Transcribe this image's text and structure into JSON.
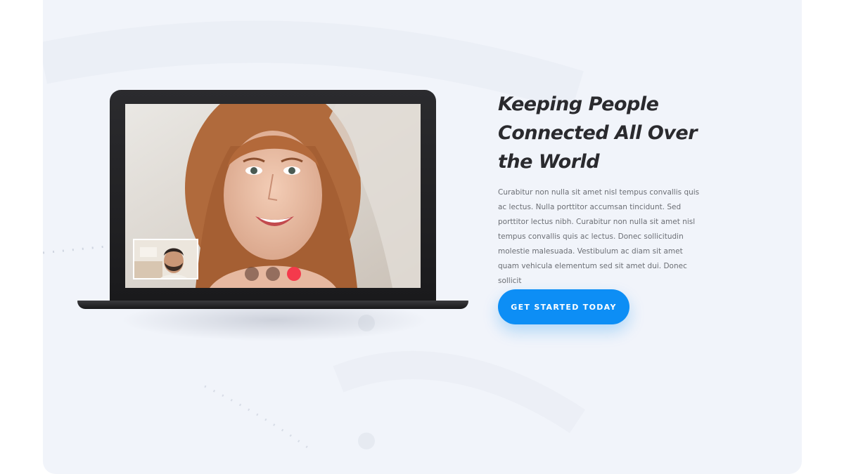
{
  "hero": {
    "heading_lines": [
      "Keeping People",
      "Connected All Over",
      "the World"
    ],
    "body": "Curabitur non nulla sit amet nisl tempus convallis quis ac lectus. Nulla porttitor accumsan tincidunt. Sed porttitor lectus nibh. Curabitur non nulla sit amet nisl tempus convallis quis ac lectus. Donec sollicitudin molestie malesuada. Vestibulum ac diam sit amet quam vehicula elementum sed sit amet dui. Donec sollicit",
    "cta_label": "GET STARTED TODAY"
  },
  "video_call": {
    "main_participant": "smiling-woman-photo",
    "self_view": "bearded-man-photo",
    "controls": [
      "control-dot",
      "control-dot",
      "end-call-dot"
    ]
  },
  "colors": {
    "background": "#f1f4fa",
    "accent": "#0d8ef5",
    "end_call": "#f43a4c",
    "heading": "#2a2a2e",
    "body": "#6b6e74"
  }
}
